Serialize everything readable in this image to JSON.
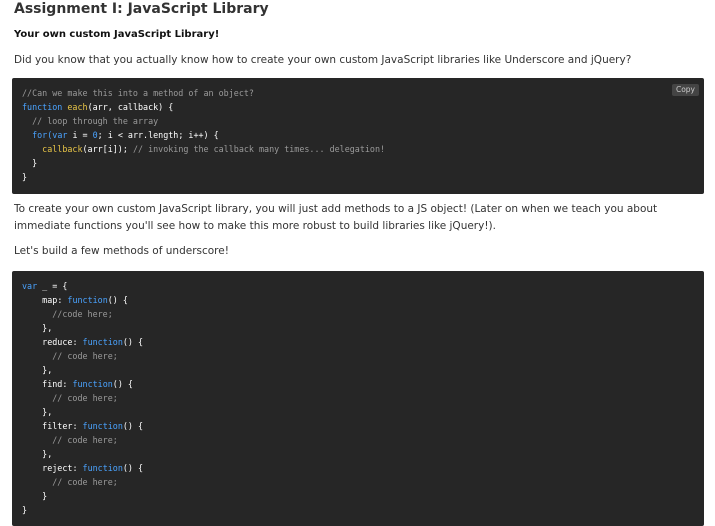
{
  "title": "Assignment I: JavaScript Library",
  "subtitle": "Your own custom JavaScript Library!",
  "intro": "Did you know that you actually know how to create your own custom JavaScript libraries like Underscore and jQuery?",
  "copy_label": "Copy",
  "code1": {
    "l1_comment": "//Can we make this into a method of an object?",
    "l2_kw": "function",
    "l2_name": "each",
    "l2_rest": "(arr, callback) {",
    "l3_comment": "// loop through the array",
    "l4_kw": "for",
    "l4_a": "(var",
    "l4_b": " i = ",
    "l4_num": "0",
    "l4_c": "; i < arr.length; i++) {",
    "l5_fn": "callback",
    "l5_rest": "(arr[i]);",
    "l5_comment": "// invoking the callback many times... delegation!",
    "l6": "}",
    "l7": "}"
  },
  "para2": "To create your own custom JavaScript library, you will just add methods to a JS object! (Later on when we teach you about immediate functions you'll see how to make this more robust to build libraries like jQuery!).",
  "para3": "Let's build a few methods of underscore!",
  "code2": {
    "var_kw": "var",
    "var_rest": " _ = {",
    "fn_kw": "function",
    "fn_paren": "() {",
    "close_comma": "},",
    "close_brace": "}",
    "methods": [
      {
        "name": "map",
        "comment": "//code here;"
      },
      {
        "name": "reduce",
        "comment": "// code here;"
      },
      {
        "name": "find",
        "comment": "// code here;"
      },
      {
        "name": "filter",
        "comment": "// code here;"
      },
      {
        "name": "reject",
        "comment": "// code here;"
      }
    ]
  }
}
